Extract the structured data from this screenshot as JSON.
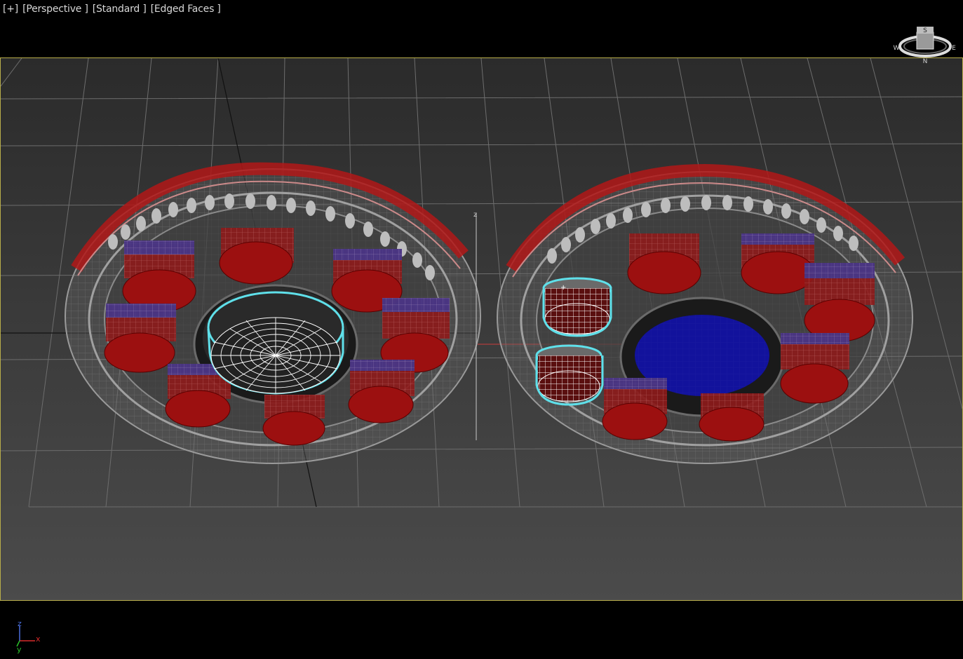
{
  "viewport": {
    "labels": [
      "[+]",
      "[Perspective ]",
      "[Standard ]",
      "[Edged Faces ]"
    ],
    "border_color": "#b8ad4a",
    "background_top": "#2c2c2c",
    "background_bottom": "#4a4a4a"
  },
  "viewcube": {
    "top": "S",
    "left": "W",
    "right": "E",
    "bottom": "N"
  },
  "gizmo": {
    "z_label": "z",
    "x_label": "x"
  },
  "axis_tripod": {
    "z": "z",
    "x": "x",
    "y": "y"
  },
  "colors": {
    "roller_red": "#9c1010",
    "roller_blue": "#2a2ab0",
    "selection_cyan": "#5fe0ea",
    "inner_race_blue": "#0b0b9c",
    "wire_gray": "#9a9a9a",
    "rim_red": "#b11818"
  },
  "icons": [
    "viewcube-icon",
    "axis-tripod-icon",
    "transform-gizmo-icon"
  ]
}
